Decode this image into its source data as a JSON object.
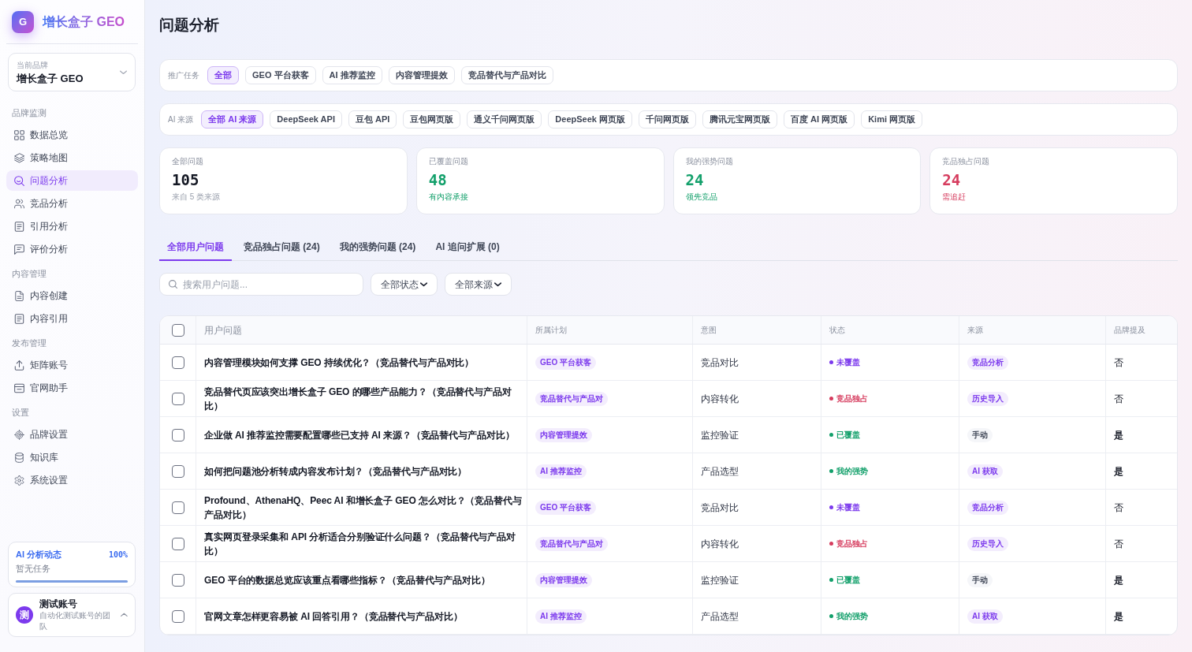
{
  "sidebar": {
    "logo": {
      "mark": "G",
      "title": "增长盒子 GEO"
    },
    "brand_selector": {
      "label": "当前品牌",
      "value": "增长盒子 GEO"
    },
    "sections": [
      {
        "title": "品牌监测",
        "items": [
          {
            "label": "数据总览",
            "selected": false
          },
          {
            "label": "策略地图",
            "selected": false
          },
          {
            "label": "问题分析",
            "selected": true
          },
          {
            "label": "竞品分析",
            "selected": false
          },
          {
            "label": "引用分析",
            "selected": false
          },
          {
            "label": "评价分析",
            "selected": false
          }
        ]
      },
      {
        "title": "内容管理",
        "items": [
          {
            "label": "内容创建",
            "selected": false
          },
          {
            "label": "内容引用",
            "selected": false
          }
        ]
      },
      {
        "title": "发布管理",
        "items": [
          {
            "label": "矩阵账号",
            "selected": false
          },
          {
            "label": "官网助手",
            "selected": false
          }
        ]
      },
      {
        "title": "设置",
        "items": [
          {
            "label": "品牌设置",
            "selected": false
          },
          {
            "label": "知识库",
            "selected": false
          },
          {
            "label": "系统设置",
            "selected": false
          }
        ]
      }
    ],
    "ai_status": {
      "title": "AI 分析动态",
      "percent": "100%",
      "message": "暂无任务",
      "level": 1
    },
    "account": {
      "avatar": "测",
      "name": "测试账号",
      "team": "自动化测试账号的团队"
    }
  },
  "page": {
    "title": "问题分析"
  },
  "filters": [
    {
      "label": "推广任务",
      "chips": [
        {
          "label": "全部",
          "selected": true
        },
        {
          "label": "GEO 平台获客",
          "selected": false
        },
        {
          "label": "AI 推荐监控",
          "selected": false
        },
        {
          "label": "内容管理提效",
          "selected": false
        },
        {
          "label": "竞品替代与产品对比",
          "selected": false
        }
      ]
    },
    {
      "label": "AI 来源",
      "chips": [
        {
          "label": "全部 AI 来源",
          "selected": true
        },
        {
          "label": "DeepSeek API",
          "selected": false
        },
        {
          "label": "豆包 API",
          "selected": false
        },
        {
          "label": "豆包网页版",
          "selected": false
        },
        {
          "label": "通义千问网页版",
          "selected": false
        },
        {
          "label": "DeepSeek 网页版",
          "selected": false
        },
        {
          "label": "千问网页版",
          "selected": false
        },
        {
          "label": "腾讯元宝网页版",
          "selected": false
        },
        {
          "label": "百度 AI 网页版",
          "selected": false
        },
        {
          "label": "Kimi 网页版",
          "selected": false
        }
      ]
    }
  ],
  "stats": [
    {
      "label": "全部问题",
      "value": "105",
      "note": "来自 5 类来源",
      "kind": "neutral"
    },
    {
      "label": "已覆盖问题",
      "value": "48",
      "note": "有内容承接",
      "kind": "positive"
    },
    {
      "label": "我的强势问题",
      "value": "24",
      "note": "领先竞品",
      "kind": "positive"
    },
    {
      "label": "竞品独占问题",
      "value": "24",
      "note": "需追赶",
      "kind": "negative"
    }
  ],
  "tabs": [
    {
      "label": "全部用户问题",
      "selected": true
    },
    {
      "label": "竞品独占问题 (24)",
      "selected": false
    },
    {
      "label": "我的强势问题 (24)",
      "selected": false
    },
    {
      "label": "AI 追问扩展 (0)",
      "selected": false
    }
  ],
  "toolbar": {
    "search": {
      "placeholder": "搜索用户问题..."
    },
    "selects": [
      {
        "value": "全部状态"
      },
      {
        "value": "全部来源"
      }
    ]
  },
  "table": {
    "select_all": {
      "checked": false
    },
    "columns": [
      "用户问题",
      "所属计划",
      "意图",
      "状态",
      "来源",
      "品牌提及"
    ],
    "rows": [
      {
        "checked": false,
        "question": "内容管理模块如何支撑 GEO 持续优化？（竞品替代与产品对比）",
        "plan": "GEO 平台获客",
        "intent": "竞品对比",
        "status": {
          "label": "未覆盖",
          "color": "#7c3aed"
        },
        "source": {
          "label": "竞品分析",
          "kind": "auto"
        },
        "brand_mention": {
          "label": "否",
          "mentioned": false
        }
      },
      {
        "checked": false,
        "question": "竞品替代页应该突出增长盒子 GEO 的哪些产品能力？（竞品替代与产品对比）",
        "plan": "竞品替代与产品对",
        "intent": "内容转化",
        "status": {
          "label": "竞品独占",
          "color": "#d63c5e"
        },
        "source": {
          "label": "历史导入",
          "kind": "auto"
        },
        "brand_mention": {
          "label": "否",
          "mentioned": false
        }
      },
      {
        "checked": false,
        "question": "企业做 AI 推荐监控需要配置哪些已支持 AI 来源？（竞品替代与产品对比）",
        "plan": "内容管理提效",
        "intent": "监控验证",
        "status": {
          "label": "已覆盖",
          "color": "#13a06b"
        },
        "source": {
          "label": "手动",
          "kind": "manual"
        },
        "brand_mention": {
          "label": "是",
          "mentioned": true
        }
      },
      {
        "checked": false,
        "question": "如何把问题池分析转成内容发布计划？（竞品替代与产品对比）",
        "plan": "AI 推荐监控",
        "intent": "产品选型",
        "status": {
          "label": "我的强势",
          "color": "#13a06b"
        },
        "source": {
          "label": "AI 获取",
          "kind": "auto"
        },
        "brand_mention": {
          "label": "是",
          "mentioned": true
        }
      },
      {
        "checked": false,
        "question": "Profound、AthenaHQ、Peec AI 和增长盒子 GEO 怎么对比？（竞品替代与产品对比）",
        "plan": "GEO 平台获客",
        "intent": "竞品对比",
        "status": {
          "label": "未覆盖",
          "color": "#7c3aed"
        },
        "source": {
          "label": "竞品分析",
          "kind": "auto"
        },
        "brand_mention": {
          "label": "否",
          "mentioned": false
        }
      },
      {
        "checked": false,
        "question": "真实网页登录采集和 API 分析适合分别验证什么问题？（竞品替代与产品对比）",
        "plan": "竞品替代与产品对",
        "intent": "内容转化",
        "status": {
          "label": "竞品独占",
          "color": "#d63c5e"
        },
        "source": {
          "label": "历史导入",
          "kind": "auto"
        },
        "brand_mention": {
          "label": "否",
          "mentioned": false
        }
      },
      {
        "checked": false,
        "question": "GEO 平台的数据总览应该重点看哪些指标？（竞品替代与产品对比）",
        "plan": "内容管理提效",
        "intent": "监控验证",
        "status": {
          "label": "已覆盖",
          "color": "#13a06b"
        },
        "source": {
          "label": "手动",
          "kind": "manual"
        },
        "brand_mention": {
          "label": "是",
          "mentioned": true
        }
      },
      {
        "checked": false,
        "question": "官网文章怎样更容易被 AI 回答引用？（竞品替代与产品对比）",
        "plan": "AI 推荐监控",
        "intent": "产品选型",
        "status": {
          "label": "我的强势",
          "color": "#13a06b"
        },
        "source": {
          "label": "AI 获取",
          "kind": "auto"
        },
        "brand_mention": {
          "label": "是",
          "mentioned": true
        }
      }
    ]
  }
}
